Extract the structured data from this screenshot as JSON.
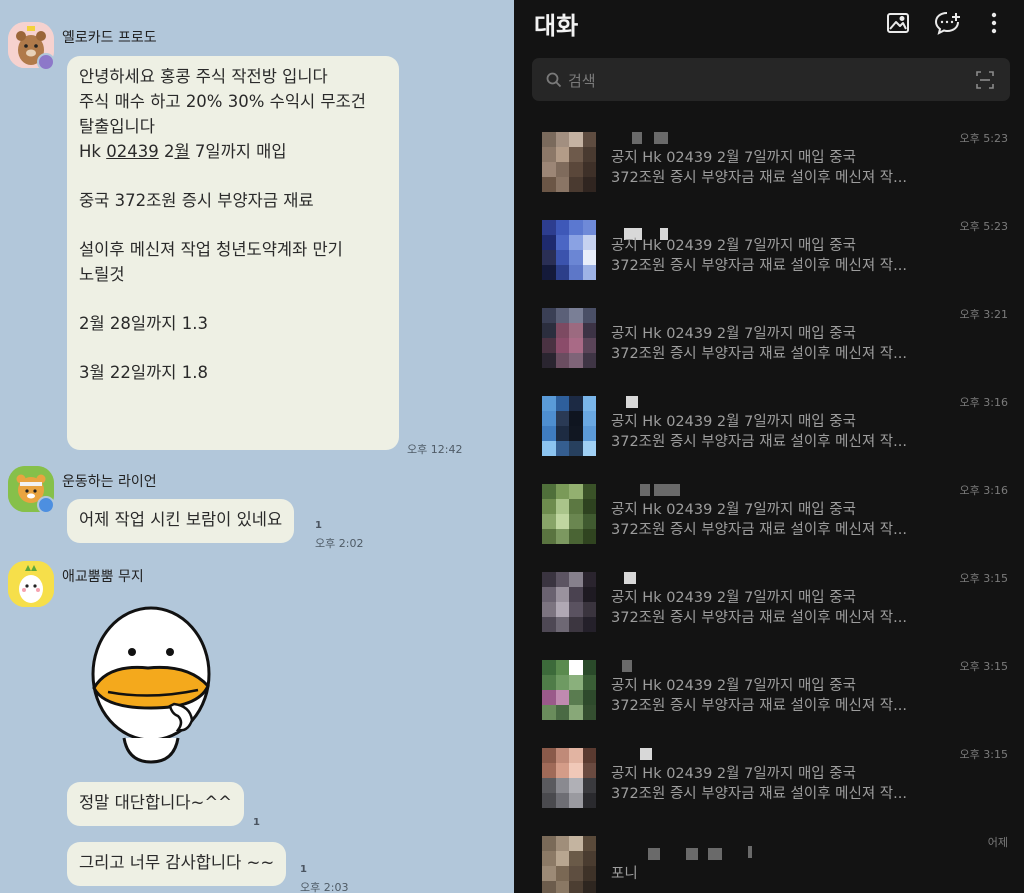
{
  "chat": {
    "messages": [
      {
        "sender": "옐로카드 프로도",
        "lines": [
          "안녕하세요 홍콩 주식 작전방 입니다",
          "주식 매수 하고 20% 30% 수익시 무조건",
          "탈출입니다"
        ],
        "line4_prefix": "Hk ",
        "line4_link": "02439",
        "line4_mid": " 2",
        "line4_link2": "월",
        "line4_suffix": " 7일까지 매입",
        "para2": "중국 372조원 증시 부양자금 재료",
        "para3a": "설이후 메신져 작업 청년도약계좌 만기",
        "para3b": "노릴것",
        "para4": "2월 28일까지 1.3",
        "para5": "3월 22일까지 1.8",
        "time": "오후 12:42"
      },
      {
        "sender": "운동하는 라이언",
        "text": "어제 작업 시킨 보람이 있네요",
        "unread": "1",
        "time": "오후 2:02"
      },
      {
        "sender": "애교뿜뿜 무지",
        "text1": "정말 대단합니다~^^",
        "unread1": "1",
        "text2": "그리고 너무 감사합니다 ~~",
        "unread2": "1",
        "time": "오후 2:03"
      }
    ]
  },
  "chat_list": {
    "title": "대화",
    "search_placeholder": "검색",
    "icons": [
      "image-icon",
      "new-chat-icon",
      "more-vertical-icon",
      "search-icon",
      "scan-icon"
    ],
    "rows": [
      {
        "line1": "공지 Hk 02439 2월 7일까지 매입  중국",
        "line2": "372조원 증시 부양자금 재료 설이후 메신져 작...",
        "time": "오후 5:23",
        "colors": [
          "#7a6a5c",
          "#a28f80",
          "#c4b2a2",
          "#5e4c40",
          "#8c7868",
          "#b39c88",
          "#6e5a4b",
          "#493a30",
          "#9c8676",
          "#7f6b5c",
          "#5a473a",
          "#3e3028",
          "#6b5646",
          "#8a7565",
          "#4a3a30",
          "#302520"
        ]
      },
      {
        "line1": "공지 Hk 02439 2월 7일까지 매입  중국",
        "line2": "372조원 증시 부양자금 재료 설이후 메신져 작...",
        "time": "오후 5:23",
        "colors": [
          "#2d3d8f",
          "#3e58b8",
          "#5b78d0",
          "#6f8ad8",
          "#1e2a6e",
          "#4b66c4",
          "#8aa2e3",
          "#c6d2f0",
          "#2a2f55",
          "#3b53ad",
          "#6b86d4",
          "#e8eefa",
          "#141a3a",
          "#2c3f8a",
          "#5d77c8",
          "#9eb3e6"
        ]
      },
      {
        "line1": "공지 Hk 02439 2월 7일까지 매입  중국",
        "line2": "372조원 증시 부양자금 재료 설이후 메신져 작...",
        "time": "오후 3:21",
        "colors": [
          "#3a3f55",
          "#5b6078",
          "#7a7f96",
          "#4a4f66",
          "#2b2e3e",
          "#7d4a62",
          "#9c6a80",
          "#3c3345",
          "#4a3242",
          "#8b4c6a",
          "#a96a86",
          "#5a4458",
          "#2a2530",
          "#6a4d60",
          "#7f6478",
          "#3f3545"
        ]
      },
      {
        "line1": "공지 Hk 02439 2월 7일까지 매입  중국",
        "line2": "372조원 증시 부양자금 재료 설이후 메신져 작...",
        "time": "오후 3:16",
        "colors": [
          "#5a9bd8",
          "#2e5f9c",
          "#1c2a44",
          "#7ab6ea",
          "#4e8ed0",
          "#2a3a55",
          "#0f1520",
          "#6aa8e2",
          "#3f7cc0",
          "#1d2b42",
          "#111722",
          "#5c9ad8",
          "#8cc4f0",
          "#355e90",
          "#27405e",
          "#a0d0f4"
        ]
      },
      {
        "line1": "공지 Hk 02439 2월 7일까지 매입  중국",
        "line2": "372조원 증시 부양자금 재료 설이후 메신져 작...",
        "time": "오후 3:16",
        "colors": [
          "#4f6f3a",
          "#7a9a58",
          "#93b070",
          "#3a5228",
          "#6e8c4e",
          "#aac48a",
          "#5c7842",
          "#2e4220",
          "#88a468",
          "#c0d6a0",
          "#6a8650",
          "#405a30",
          "#5a7440",
          "#7c9860",
          "#4a6434",
          "#304420"
        ]
      },
      {
        "line1": "공지 Hk 02439 2월 7일까지 매입  중국",
        "line2": "372조원 증시 부양자금 재료 설이후 메신져 작...",
        "time": "오후 3:15",
        "colors": [
          "#3a3440",
          "#5c5462",
          "#86808c",
          "#2a242e",
          "#6a6270",
          "#9a929e",
          "#4a4250",
          "#1e1a22",
          "#7c7480",
          "#b0a8b4",
          "#5a5260",
          "#3a343e",
          "#4e4854",
          "#6e6874",
          "#3c3640",
          "#24202a"
        ]
      },
      {
        "line1": "공지 Hk 02439 2월 7일까지 매입  중국",
        "line2": "372조원 증시 부양자금 재료 설이후 메신져 작...",
        "time": "오후 3:15",
        "colors": [
          "#3c6a3a",
          "#5a8a4e",
          "#ffffff",
          "#2a4a2a",
          "#4f7c48",
          "#6e9a62",
          "#8ab07c",
          "#3a5e36",
          "#9a5a8a",
          "#c08ab0",
          "#5a7c50",
          "#2e4a2c",
          "#6a8c5c",
          "#4a6a44",
          "#88a878",
          "#344e30"
        ]
      },
      {
        "line1": "공지 Hk 02439 2월 7일까지 매입  중국",
        "line2": "372조원 증시 부양자금 재료 설이후 메신져 작...",
        "time": "오후 3:15",
        "colors": [
          "#8a5a4a",
          "#c08a78",
          "#e2b4a2",
          "#5a3a30",
          "#a06a58",
          "#d49c88",
          "#f0c8b8",
          "#6a4a40",
          "#5a5a5e",
          "#8a8a90",
          "#b0b0b6",
          "#3a3a3e",
          "#4a4a4e",
          "#6e6e74",
          "#9a9aa0",
          "#2a2a2e"
        ]
      },
      {
        "line1": "포니",
        "line2": "",
        "time": "어제",
        "colors": [
          "#7a6a58",
          "#a08e7a",
          "#c4b4a0",
          "#5a4a3a",
          "#8c7a66",
          "#b8a690",
          "#6a5a48",
          "#4a3c30",
          "#9c8a76",
          "#7a6854",
          "#5e4e40",
          "#3e3228",
          "#6c5c4c",
          "#8a7864",
          "#4c3e32",
          "#2e2620"
        ]
      }
    ]
  }
}
